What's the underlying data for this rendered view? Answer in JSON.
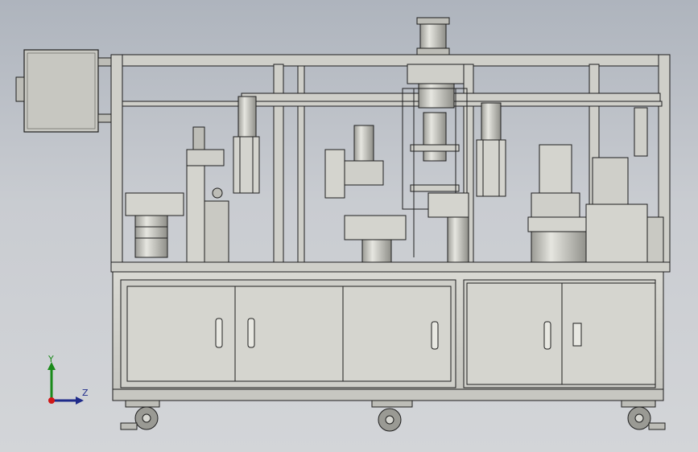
{
  "viewport": {
    "background_top": "#aeb4bd",
    "background_bottom": "#d3d5d8"
  },
  "model": {
    "line_color": "#1e1e1e",
    "fill_color": "#d8d8d2",
    "panel_color": "#c9c9c3",
    "shadow_color": "#8a8a84"
  },
  "triad": {
    "y_label": "Y",
    "z_label": "Z",
    "y_color": "#1a8a1a",
    "z_color": "#1f2b8a",
    "x_color": "#d01818",
    "icons": [
      "y-axis-arrow-icon",
      "z-axis-arrow-icon",
      "x-axis-origin-icon"
    ]
  }
}
